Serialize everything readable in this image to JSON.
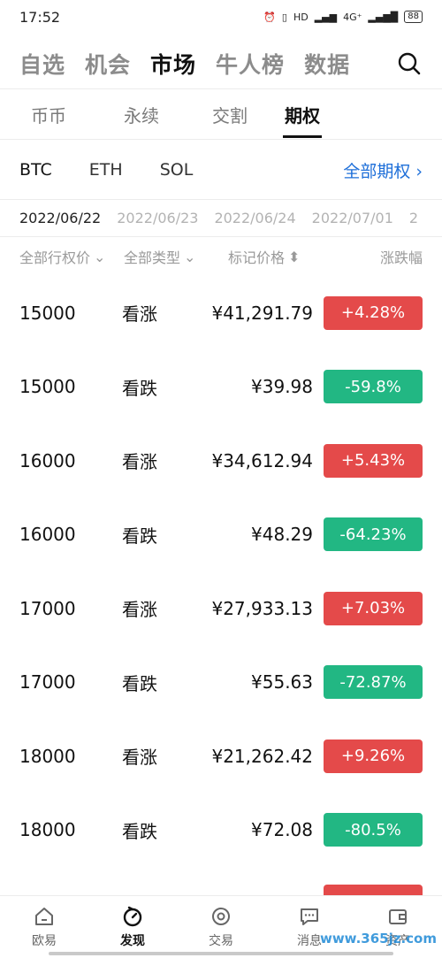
{
  "status_bar": {
    "time": "17:52",
    "signal_text": "4G⁺",
    "battery": "88"
  },
  "top_nav": {
    "tabs": [
      "自选",
      "机会",
      "市场",
      "牛人榜",
      "数据"
    ],
    "active": 2
  },
  "sub_tabs": {
    "tabs": [
      "币币",
      "永续",
      "交割",
      "期权"
    ],
    "active": 3
  },
  "coins": {
    "items": [
      "BTC",
      "ETH",
      "SOL"
    ],
    "active": 0,
    "all_options": "全部期权 ›"
  },
  "dates": {
    "items": [
      "2022/06/22",
      "2022/06/23",
      "2022/06/24",
      "2022/07/01",
      "2"
    ],
    "active": 0
  },
  "filters": {
    "strike": "全部行权价",
    "type": "全部类型",
    "mark_price": "标记价格",
    "change": "涨跌幅"
  },
  "rows": [
    {
      "strike": "15000",
      "type": "看涨",
      "price": "¥41,291.79",
      "change": "+4.28%",
      "dir": "up"
    },
    {
      "strike": "15000",
      "type": "看跌",
      "price": "¥39.98",
      "change": "-59.8%",
      "dir": "down"
    },
    {
      "strike": "16000",
      "type": "看涨",
      "price": "¥34,612.94",
      "change": "+5.43%",
      "dir": "up"
    },
    {
      "strike": "16000",
      "type": "看跌",
      "price": "¥48.29",
      "change": "-64.23%",
      "dir": "down"
    },
    {
      "strike": "17000",
      "type": "看涨",
      "price": "¥27,933.13",
      "change": "+7.03%",
      "dir": "up"
    },
    {
      "strike": "17000",
      "type": "看跌",
      "price": "¥55.63",
      "change": "-72.87%",
      "dir": "down"
    },
    {
      "strike": "18000",
      "type": "看涨",
      "price": "¥21,262.42",
      "change": "+9.26%",
      "dir": "up"
    },
    {
      "strike": "18000",
      "type": "看跌",
      "price": "¥72.08",
      "change": "-80.5%",
      "dir": "down"
    }
  ],
  "bottom_nav": {
    "items": [
      "欧易",
      "发现",
      "交易",
      "消息",
      "资产"
    ],
    "active": 1
  },
  "watermark": "www.365jz.com",
  "colors": {
    "up": "#e44a4a",
    "down": "#22b783",
    "accent": "#1e6fd9"
  }
}
